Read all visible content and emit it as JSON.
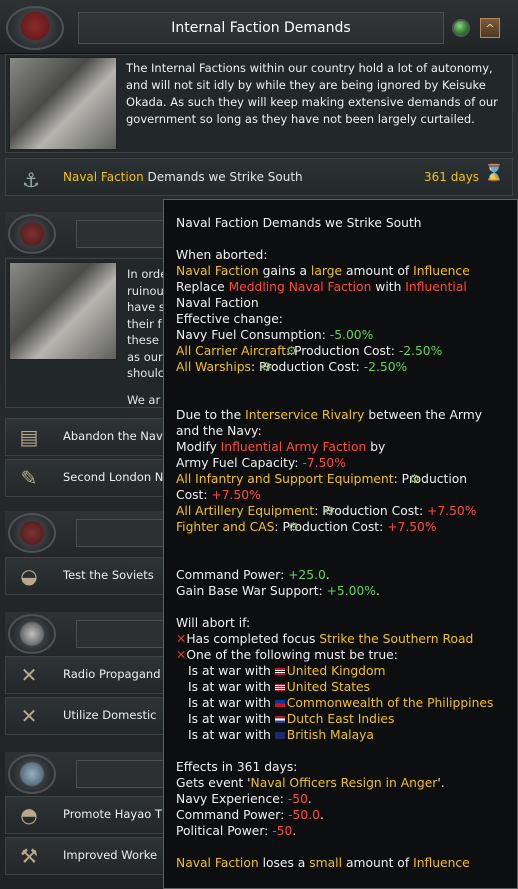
{
  "window": {
    "title": "Internal Faction Demands",
    "minimize_glyph": "^"
  },
  "description": "The Internal Factions within our country hold a lot of autonomy, and will not sit idly by while they are being ignored by Keisuke Okada. As such they will keep making extensive demands of our government so long as they have not been largely curtailed.",
  "demand": {
    "faction": "Naval Faction",
    "text": " Demands we Strike South",
    "days": "361 days"
  },
  "partial_text": [
    "In orde",
    "ruinou",
    "have s",
    "their f",
    "these",
    "as our",
    "shoulc",
    "We ar"
  ],
  "side_items": [
    {
      "label": "Abandon the Nav"
    },
    {
      "label": "Second London N"
    },
    {
      "label": "Test the Soviets"
    },
    {
      "label": "Radio Propagand"
    },
    {
      "label": "Utilize Domestic"
    },
    {
      "label": "Promote Hayao T"
    },
    {
      "label": "Improved Worke"
    }
  ],
  "tooltip": {
    "title": "Naval Faction Demands we Strike South",
    "when_aborted": "When aborted:",
    "line1": {
      "a": "Naval Faction",
      "b": " gains a ",
      "c": "large",
      "d": " amount of ",
      "e": "Influence"
    },
    "line2": {
      "a": "Replace ",
      "b": "Meddling Naval Faction",
      "c": " with ",
      "d": "Influential"
    },
    "line3": "Naval Faction",
    "effective_change": "Effective change:",
    "fuel": {
      "label": "Navy Fuel Consumption: ",
      "value": "-5.00%"
    },
    "carrier": {
      "a": "All Carrier Aircraft",
      "b": ":  Production Cost:  ",
      "c": "-2.50%"
    },
    "warships": {
      "a": "All Warships",
      "b": ":  Production Cost:  ",
      "c": "-2.50%"
    },
    "rivalry1": {
      "a": "Due to the ",
      "b": "Interservice Rivalry",
      "c": " between the Army"
    },
    "rivalry2": "and the Navy:",
    "modify": {
      "a": "Modify ",
      "b": "Influential Army Faction",
      "c": " by"
    },
    "army_fuel": {
      "a": "Army Fuel Capacity: ",
      "b": "-7.50%"
    },
    "infantry1": {
      "a": "All Infantry and Support Equipment",
      "b": ":  Production"
    },
    "infantry2": {
      "a": "Cost: ",
      "b": "+7.50%"
    },
    "artillery": {
      "a": "All Artillery Equipment",
      "b": ":  Production Cost:  ",
      "c": "+7.50%"
    },
    "fighter": {
      "a": "Fighter and CAS",
      "b": ":  Production Cost:  ",
      "c": "+7.50%"
    },
    "command_power": {
      "a": "Command Power: ",
      "b": "+25.0",
      "c": "."
    },
    "war_support": {
      "a": "Gain Base War Support: ",
      "b": "+5.00%",
      "c": "."
    },
    "will_abort": "Will abort if:",
    "abort1": {
      "a": "Has completed focus ",
      "b": "Strike the Southern Road"
    },
    "abort2": "One of the following must be true:",
    "wars": [
      {
        "prefix": "Is at war with ",
        "name": "United Kingdom"
      },
      {
        "prefix": "Is at war with ",
        "name": "United States"
      },
      {
        "prefix": "Is at war with ",
        "name": "Commonwealth of the Philippines"
      },
      {
        "prefix": "Is at war with ",
        "name": "Dutch East Indies"
      },
      {
        "prefix": "Is at war with ",
        "name": "British Malaya"
      }
    ],
    "effects_in": "Effects in 361 days:",
    "event": {
      "a": "Gets event '",
      "b": "Naval Officers Resign in Anger",
      "c": "'."
    },
    "navy_xp": {
      "a": "Navy Experience: ",
      "b": "-50",
      "c": "."
    },
    "cmd_power2": {
      "a": "Command Power: ",
      "b": "-50.0",
      "c": "."
    },
    "pol_power": {
      "a": "Political Power: ",
      "b": "-50",
      "c": "."
    },
    "final": {
      "a": "Naval Faction",
      "b": " loses a ",
      "c": "small",
      "d": " amount of ",
      "e": "Influence"
    }
  }
}
